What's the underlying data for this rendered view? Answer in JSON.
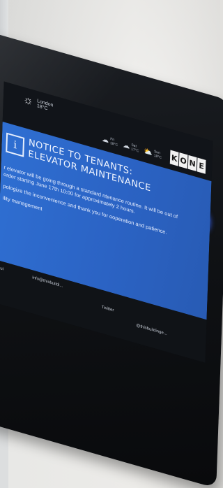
{
  "screen": {
    "weather_current": {
      "city": "London",
      "temp": "18°C",
      "icon": "sun-icon"
    },
    "forecast": [
      {
        "day": "Fri",
        "temp": "18°C",
        "icon": "rain-cloud-icon"
      },
      {
        "day": "Sat",
        "temp": "17°C",
        "icon": "cloud-icon"
      },
      {
        "day": "Sun",
        "temp": "18°C",
        "icon": "sun-cloud-icon"
      }
    ],
    "brand": [
      "K",
      "O",
      "N",
      "E"
    ],
    "notice": {
      "icon_glyph": "i",
      "title_line1": "NOTICE TO TENANTS:",
      "title_line2": "ELEVATOR MAINTENANCE",
      "para1": "r elevator will be going through a standard ntenance routine. It will be out of order starting June 17th 10:00 for approximately 2 hours.",
      "para2": "pologize the inconvenience and thank you for ooperation and patience.",
      "para3": "ility management"
    },
    "footer": {
      "email": "info@thisbuildi...",
      "twitter_label": "Twitter",
      "handle": "@thisbuildinge...",
      "left_label": "ui"
    }
  },
  "colors": {
    "screen_blue": "#2f6fd2",
    "led_blue": "#2b4ed6",
    "device_black": "#0f1114"
  }
}
